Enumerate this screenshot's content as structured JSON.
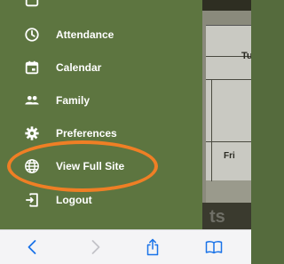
{
  "menu": {
    "items": [
      {
        "label": "Attendance",
        "icon": "clock-icon"
      },
      {
        "label": "Calendar",
        "icon": "calendar-icon"
      },
      {
        "label": "Family",
        "icon": "people-icon"
      },
      {
        "label": "Preferences",
        "icon": "gear-icon"
      },
      {
        "label": "View Full Site",
        "icon": "globe-icon"
      },
      {
        "label": "Logout",
        "icon": "logout-icon"
      }
    ]
  },
  "background_app": {
    "header_partial": "Tu",
    "day_label": "Fri",
    "footer_partial": "ts"
  },
  "browser_bar": {
    "buttons": [
      "back",
      "forward",
      "share",
      "bookmarks"
    ]
  },
  "colors": {
    "drawer": "#5d7540",
    "highlight": "#ef7f25",
    "browser_icon": "#1a73e8"
  }
}
